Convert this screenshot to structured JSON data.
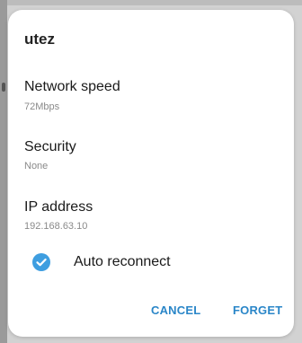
{
  "dialog": {
    "title": "utez",
    "rows": [
      {
        "label": "Network speed",
        "value": "72Mbps"
      },
      {
        "label": "Security",
        "value": "None"
      },
      {
        "label": "IP address",
        "value": "192.168.63.10"
      }
    ],
    "auto_reconnect": {
      "label": "Auto reconnect",
      "checked": true
    },
    "buttons": {
      "cancel": "CANCEL",
      "forget": "FORGET"
    },
    "colors": {
      "accent": "#2a86c8",
      "check": "#3e9ee0"
    }
  }
}
